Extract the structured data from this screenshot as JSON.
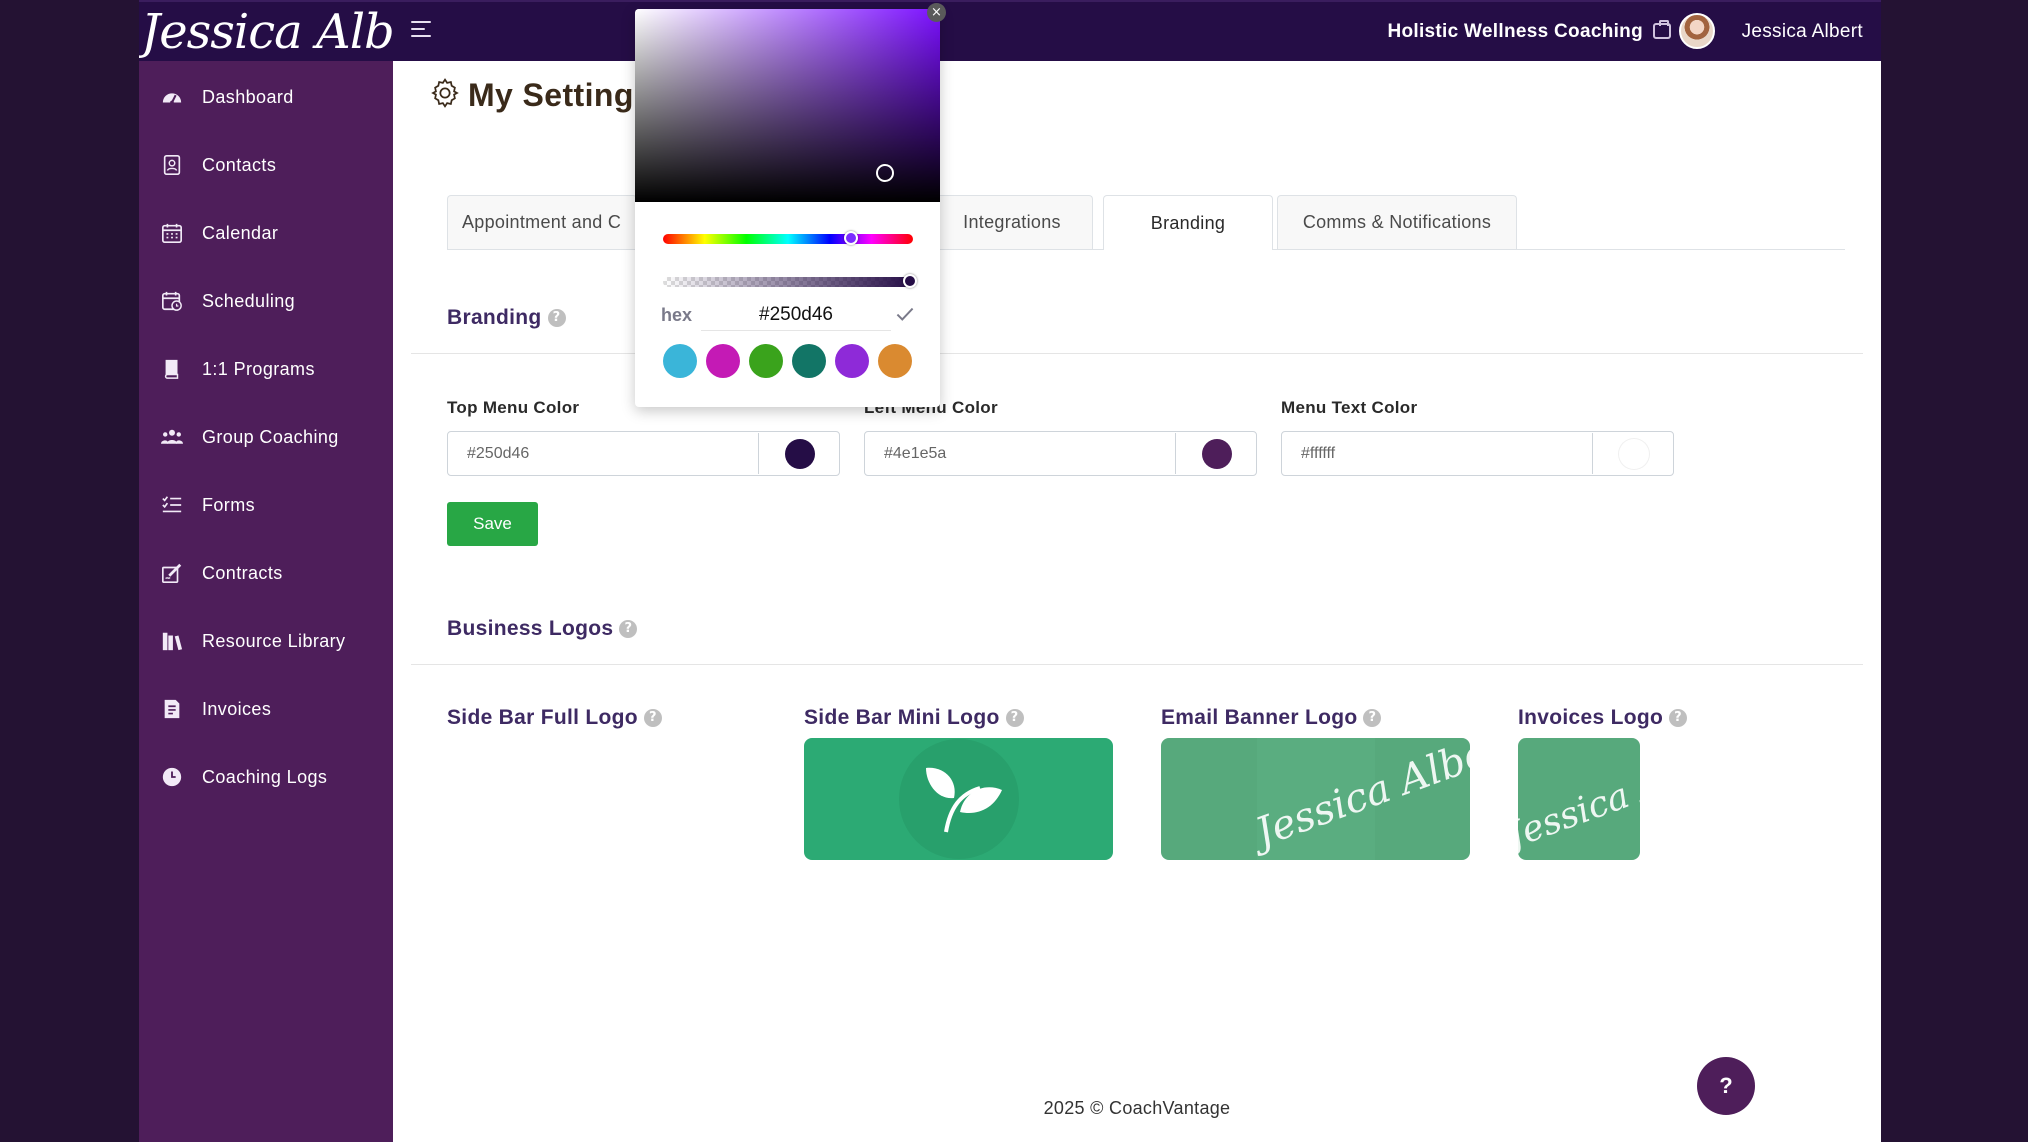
{
  "topbar": {
    "logo_text": "Jessica Albert",
    "business_name": "Holistic Wellness Coaching",
    "user_name": "Jessica Albert"
  },
  "sidebar": {
    "items": [
      {
        "label": "Dashboard",
        "icon": "dashboard-icon"
      },
      {
        "label": "Contacts",
        "icon": "contacts-icon"
      },
      {
        "label": "Calendar",
        "icon": "calendar-icon"
      },
      {
        "label": "Scheduling",
        "icon": "scheduling-icon"
      },
      {
        "label": "1:1 Programs",
        "icon": "book-icon"
      },
      {
        "label": "Group Coaching",
        "icon": "group-icon"
      },
      {
        "label": "Forms",
        "icon": "checklist-icon"
      },
      {
        "label": "Contracts",
        "icon": "signature-icon"
      },
      {
        "label": "Resource Library",
        "icon": "library-icon"
      },
      {
        "label": "Invoices",
        "icon": "invoice-icon"
      },
      {
        "label": "Coaching Logs",
        "icon": "clock-icon"
      }
    ]
  },
  "page": {
    "title": "My Setting",
    "tabs": [
      {
        "label": "Appointment and C"
      },
      {
        "label": "Integrations"
      },
      {
        "label": "Branding",
        "active": true
      },
      {
        "label": "Comms & Notifications"
      }
    ]
  },
  "branding": {
    "section_title": "Branding",
    "fields": [
      {
        "label": "Top Menu Color",
        "value": "#250d46",
        "swatch": "#250d46"
      },
      {
        "label": "Left Menu Color",
        "value": "#4e1e5a",
        "swatch": "#4e1e5a"
      },
      {
        "label": "Menu Text Color",
        "value": "#ffffff",
        "swatch": "#ffffff"
      }
    ],
    "save_label": "Save"
  },
  "logos": {
    "section_title": "Business Logos",
    "items": [
      {
        "label": "Side Bar Full Logo"
      },
      {
        "label": "Side Bar Mini Logo"
      },
      {
        "label": "Email Banner Logo"
      },
      {
        "label": "Invoices Logo"
      }
    ],
    "script_text": "Jessica Albert"
  },
  "footer": {
    "text": "2025 © CoachVantage"
  },
  "help_fab_label": "?",
  "picker": {
    "hex_label": "hex",
    "hex_value": "#250d46",
    "presets": [
      "#3ab5d9",
      "#c41ab5",
      "#3aa31c",
      "#127566",
      "#8e2ad8",
      "#da8a30"
    ]
  },
  "colors": {
    "top_menu": "#250d46",
    "left_menu": "#4e1e5a",
    "save_button": "#28a745",
    "logo_green": "#2caa74",
    "logo_green_light": "#57a97c"
  }
}
